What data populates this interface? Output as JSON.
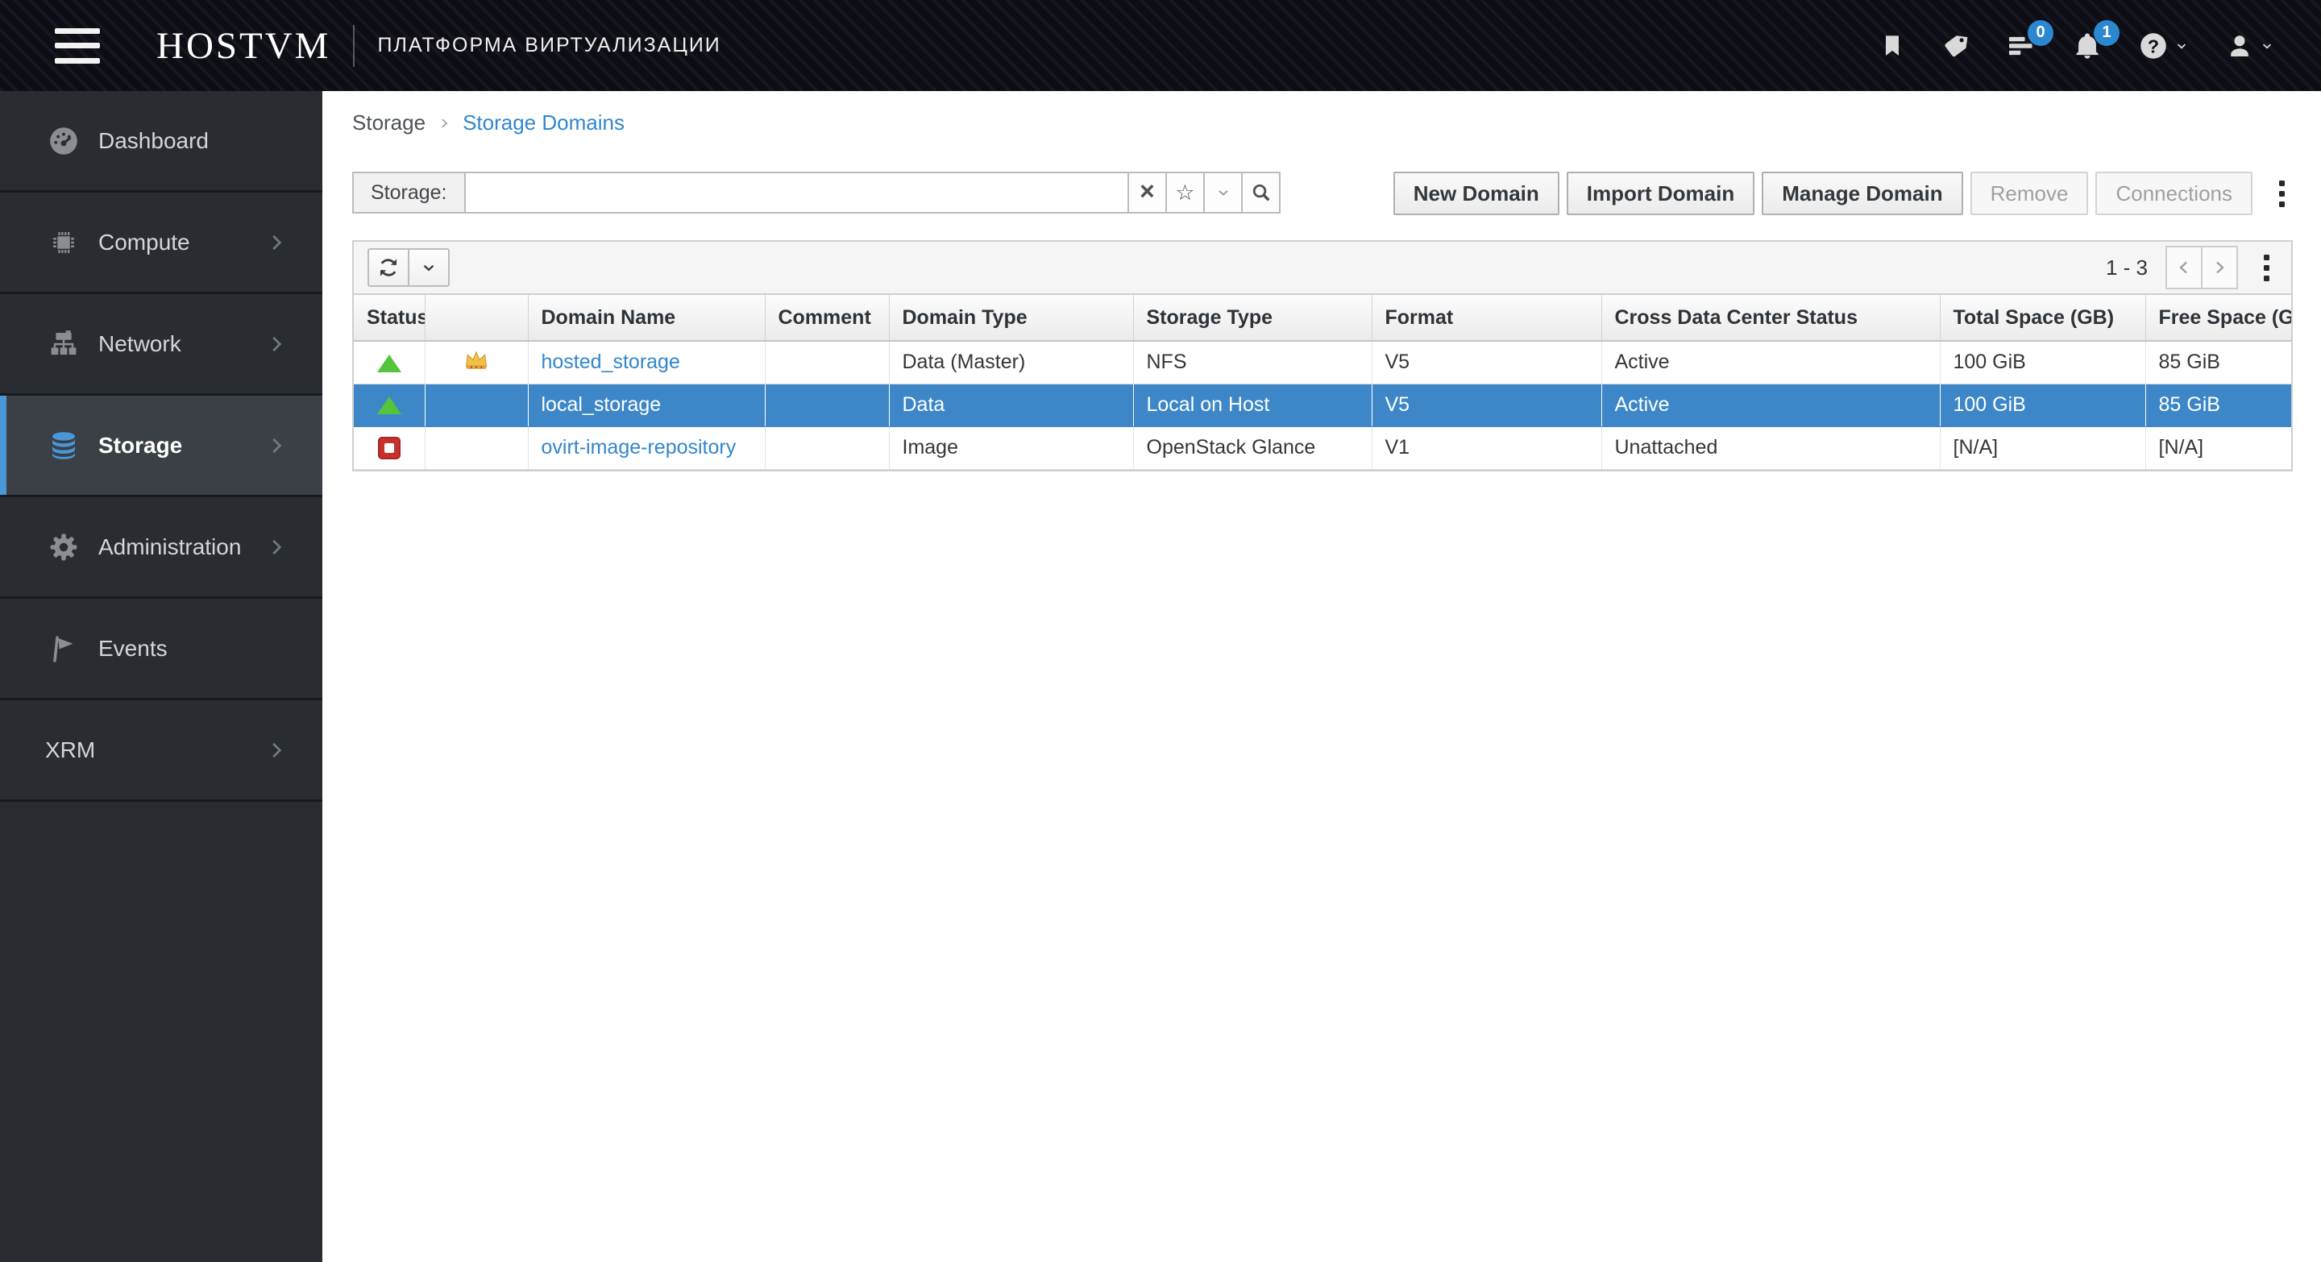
{
  "colors": {
    "link_blue": "#3286cd",
    "selected_row_blue": "#3d87c8",
    "nav_active_blue": "#4a97d7",
    "badge_blue": "#2b87d0",
    "status_up_green": "#53c43b",
    "status_down_red": "#c9302c",
    "master_crown_gold": "#f3c04a",
    "masthead_bg": "#0d0d15",
    "sidebar_bg": "#292d32"
  },
  "header": {
    "brand": "HOSTVM",
    "subtitle": "ПЛАТФОРМА ВИРТУАЛИЗАЦИИ",
    "icons": [
      "menu-icon",
      "bookmark-icon",
      "tag-icon",
      "tasks-icon",
      "bell-icon",
      "help-icon",
      "user-icon"
    ],
    "tasks_badge": "0",
    "alerts_badge": "1"
  },
  "sidebar": {
    "items": [
      {
        "label": "Dashboard",
        "icon": "dashboard-gauge-icon",
        "chevron": false,
        "active": false
      },
      {
        "label": "Compute",
        "icon": "cpu-icon",
        "chevron": true,
        "active": false
      },
      {
        "label": "Network",
        "icon": "sitemap-icon",
        "chevron": true,
        "active": false
      },
      {
        "label": "Storage",
        "icon": "database-icon",
        "chevron": true,
        "active": true
      },
      {
        "label": "Administration",
        "icon": "gear-icon",
        "chevron": true,
        "active": false
      },
      {
        "label": "Events",
        "icon": "flag-icon",
        "chevron": false,
        "active": false
      },
      {
        "label": "XRM",
        "icon": "",
        "chevron": true,
        "active": false
      }
    ]
  },
  "breadcrumb": {
    "parent": "Storage",
    "current": "Storage Domains"
  },
  "search": {
    "label": "Storage:",
    "value": "",
    "buttons": [
      "clear-icon",
      "star-icon",
      "chevron-down-icon",
      "search-icon"
    ],
    "star_glyph": "☆",
    "clear_glyph": "×"
  },
  "actions": {
    "buttons": [
      {
        "label": "New Domain",
        "enabled": true
      },
      {
        "label": "Import Domain",
        "enabled": true
      },
      {
        "label": "Manage Domain",
        "enabled": true
      },
      {
        "label": "Remove",
        "enabled": false
      },
      {
        "label": "Connections",
        "enabled": false
      }
    ]
  },
  "toolbar": {
    "pagination": "1 - 3"
  },
  "table": {
    "columns": [
      "Status",
      "",
      "Domain Name",
      "Comment",
      "Domain Type",
      "Storage Type",
      "Format",
      "Cross Data Center Status",
      "Total Space (GB)",
      "Free Space (GB)"
    ],
    "rows": [
      {
        "status": "up",
        "master": true,
        "selected": false,
        "name": "hosted_storage",
        "comment": "",
        "domain_type": "Data (Master)",
        "storage_type": "NFS",
        "format": "V5",
        "cross_dc": "Active",
        "total": "100 GiB",
        "free": "85 GiB"
      },
      {
        "status": "up",
        "master": false,
        "selected": true,
        "name": "local_storage",
        "comment": "",
        "domain_type": "Data",
        "storage_type": "Local on Host",
        "format": "V5",
        "cross_dc": "Active",
        "total": "100 GiB",
        "free": "85 GiB"
      },
      {
        "status": "down",
        "master": false,
        "selected": false,
        "name": "ovirt-image-repository",
        "comment": "",
        "domain_type": "Image",
        "storage_type": "OpenStack Glance",
        "format": "V1",
        "cross_dc": "Unattached",
        "total": "[N/A]",
        "free": "[N/A]"
      }
    ]
  }
}
